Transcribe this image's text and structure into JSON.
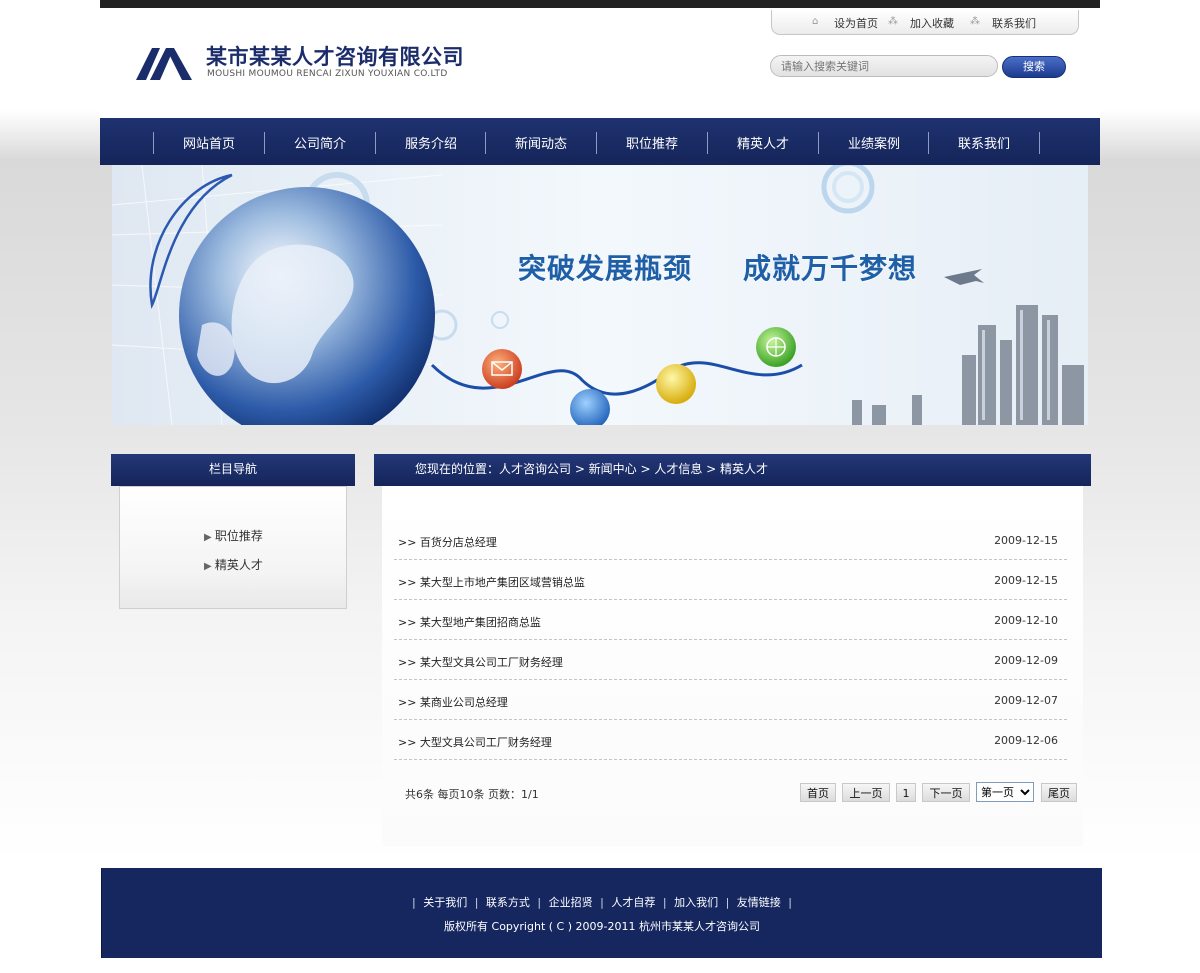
{
  "header": {
    "company_cn": "某市某某人才咨询有限公司",
    "company_en": "MOUSHI MOUMOU RENCAI ZIXUN YOUXIAN CO.LTD",
    "top_links": [
      "设为首页",
      "加入收藏",
      "联系我们"
    ],
    "search_placeholder": "请输入搜索关键词",
    "search_button": "搜索"
  },
  "nav": {
    "items": [
      "网站首页",
      "公司简介",
      "服务介绍",
      "新闻动态",
      "职位推荐",
      "精英人才",
      "业绩案例",
      "联系我们"
    ]
  },
  "banner": {
    "slogan_left": "突破发展瓶颈",
    "slogan_right": "成就万千梦想"
  },
  "sidebar": {
    "title": "栏目导航",
    "items": [
      "职位推荐",
      "精英人才"
    ]
  },
  "main": {
    "breadcrumb": "您现在的位置：人才咨询公司 > 新闻中心 > 人才信息 > 精英人才",
    "rows": [
      {
        "title": ">> 百货分店总经理",
        "date": "2009-12-15"
      },
      {
        "title": ">> 某大型上市地产集团区域营销总监",
        "date": "2009-12-15"
      },
      {
        "title": ">> 某大型地产集团招商总监",
        "date": "2009-12-10"
      },
      {
        "title": ">> 某大型文具公司工厂财务经理",
        "date": "2009-12-09"
      },
      {
        "title": ">> 某商业公司总经理",
        "date": "2009-12-07"
      },
      {
        "title": ">> 大型文具公司工厂财务经理",
        "date": "2009-12-06"
      }
    ]
  },
  "pagination": {
    "info": "共6条  每页10条  页数：1/1",
    "first": "首页",
    "prev": "上一页",
    "current": "1",
    "next": "下一页",
    "select_value": "第一页",
    "last": "尾页"
  },
  "footer": {
    "links": [
      "关于我们",
      "联系方式",
      "企业招贤",
      "人才自荐",
      "加入我们",
      "友情链接"
    ],
    "copyright": "版权所有  Copyright ( C ) 2009-2011 杭州市某某人才咨询公司"
  },
  "colors": {
    "brand_navy": "#1b2c6b",
    "nav_bg": "#1f3270",
    "footer_bg": "#162760",
    "slogan_blue": "#1f5fa8"
  }
}
